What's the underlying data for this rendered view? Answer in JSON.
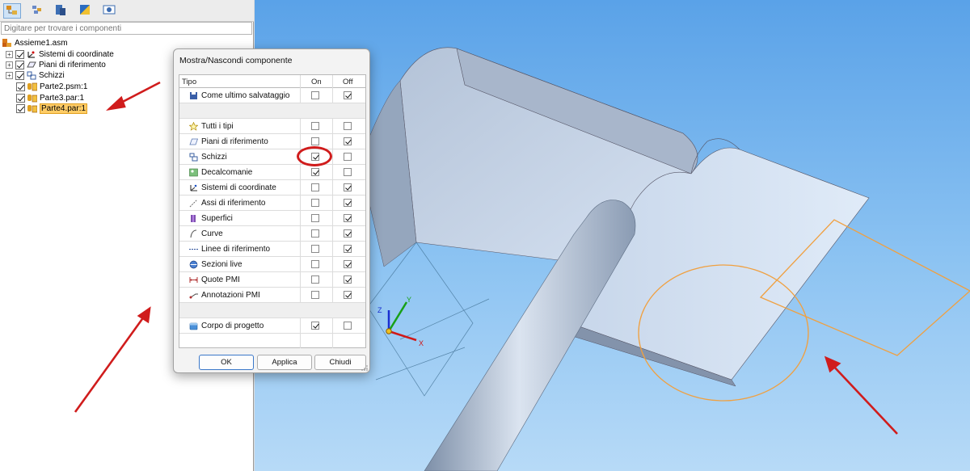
{
  "left_pane": {
    "search_placeholder": "Digitare per trovare i componenti",
    "tree": [
      {
        "label": "Assieme1.asm",
        "level": 0,
        "expander": false,
        "checkbox": false,
        "icon": "assembly-icon",
        "selected": false
      },
      {
        "label": "Sistemi di coordinate",
        "level": 1,
        "expander": true,
        "checkbox": true,
        "icon": "coordinate-system-icon",
        "selected": false
      },
      {
        "label": "Piani di riferimento",
        "level": 1,
        "expander": true,
        "checkbox": true,
        "icon": "reference-plane-icon",
        "selected": false
      },
      {
        "label": "Schizzi",
        "level": 1,
        "expander": true,
        "checkbox": true,
        "icon": "sketch-icon",
        "selected": false
      },
      {
        "label": "Parte2.psm:1",
        "level": 2,
        "expander": false,
        "checkbox": true,
        "icon": "sheetmetal-part-icon",
        "selected": false
      },
      {
        "label": "Parte3.par:1",
        "level": 2,
        "expander": false,
        "checkbox": true,
        "icon": "part-icon",
        "selected": false
      },
      {
        "label": "Parte4.par:1",
        "level": 2,
        "expander": false,
        "checkbox": true,
        "icon": "part-icon",
        "selected": true
      }
    ]
  },
  "dialog": {
    "title": "Mostra/Nascondi componente",
    "columns": {
      "type": "Tipo",
      "on": "On",
      "off": "Off"
    },
    "rows": [
      {
        "label": "Come ultimo salvataggio",
        "icon": "save-icon",
        "on": false,
        "off": true
      },
      {
        "spacer": true
      },
      {
        "label": "Tutti i tipi",
        "icon": "star-icon",
        "on": false,
        "off": false
      },
      {
        "label": "Piani di riferimento",
        "icon": "reference-plane-icon",
        "on": false,
        "off": true
      },
      {
        "label": "Schizzi",
        "icon": "sketch-icon",
        "on": true,
        "off": false
      },
      {
        "label": "Decalcomanie",
        "icon": "decal-icon",
        "on": true,
        "off": false
      },
      {
        "label": "Sistemi di coordinate",
        "icon": "coordinate-system-icon",
        "on": false,
        "off": true
      },
      {
        "label": "Assi di riferimento",
        "icon": "reference-axis-icon",
        "on": false,
        "off": true
      },
      {
        "label": "Superfici",
        "icon": "surface-icon",
        "on": false,
        "off": true
      },
      {
        "label": "Curve",
        "icon": "curve-icon",
        "on": false,
        "off": true
      },
      {
        "label": "Linee di riferimento",
        "icon": "reference-line-icon",
        "on": false,
        "off": true
      },
      {
        "label": "Sezioni live",
        "icon": "live-section-icon",
        "on": false,
        "off": true
      },
      {
        "label": "Quote PMI",
        "icon": "pmi-dimension-icon",
        "on": false,
        "off": true
      },
      {
        "label": "Annotazioni PMI",
        "icon": "pmi-annotation-icon",
        "on": false,
        "off": true
      },
      {
        "spacer": true
      },
      {
        "label": "Corpo di progetto",
        "icon": "design-body-icon",
        "on": true,
        "off": false
      }
    ],
    "buttons": {
      "ok": "OK",
      "apply": "Applica",
      "close": "Chiudi"
    }
  },
  "viewport": {
    "triad": {
      "x": "X",
      "y": "Y",
      "z": "Z"
    }
  },
  "colors": {
    "selection": "#ffcc66",
    "annotation_red": "#d01c1c",
    "sketch_orange": "#f0a040",
    "sky_top": "#5aa2e8",
    "sky_bottom": "#b7daf7"
  }
}
